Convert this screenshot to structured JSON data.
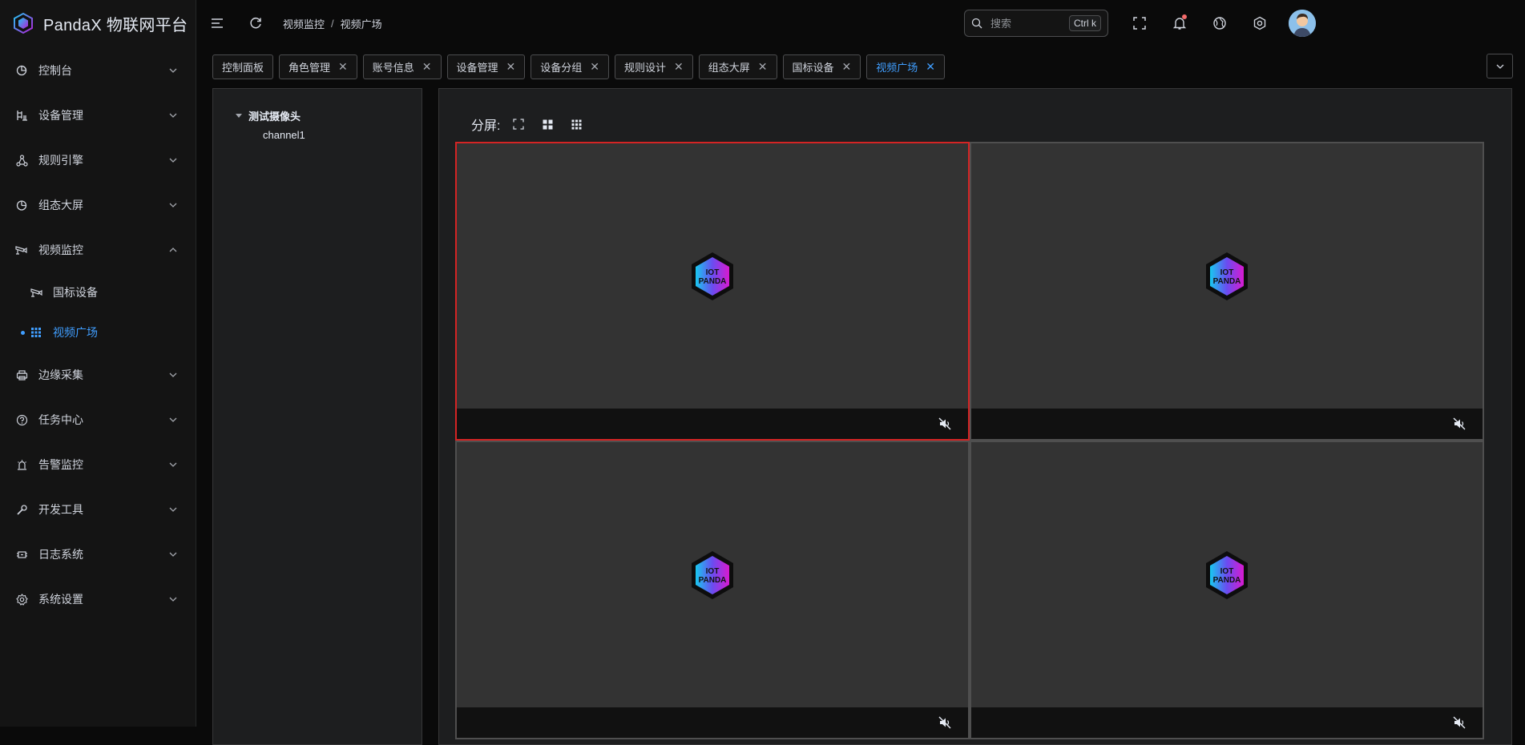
{
  "app": {
    "title": "PandaX 物联网平台"
  },
  "sidebar": {
    "items": [
      {
        "label": "控制台",
        "icon": "dashboard-icon"
      },
      {
        "label": "设备管理",
        "icon": "device-icon"
      },
      {
        "label": "规则引擎",
        "icon": "rule-icon"
      },
      {
        "label": "组态大屏",
        "icon": "pie-icon"
      },
      {
        "label": "视频监控",
        "icon": "camera-icon",
        "expanded": true,
        "children": [
          {
            "label": "国标设备",
            "icon": "camera-icon"
          },
          {
            "label": "视频广场",
            "icon": "grid-icon",
            "active": true
          }
        ]
      },
      {
        "label": "边缘采集",
        "icon": "printer-icon"
      },
      {
        "label": "任务中心",
        "icon": "question-icon"
      },
      {
        "label": "告警监控",
        "icon": "alarm-icon"
      },
      {
        "label": "开发工具",
        "icon": "wrench-icon"
      },
      {
        "label": "日志系统",
        "icon": "log-icon"
      },
      {
        "label": "系统设置",
        "icon": "gear-icon"
      }
    ]
  },
  "header": {
    "breadcrumb": [
      "视频监控",
      "视频广场"
    ],
    "search": {
      "placeholder": "搜索",
      "shortcut": "Ctrl k"
    }
  },
  "tabs": [
    {
      "label": "控制面板",
      "closable": false
    },
    {
      "label": "角色管理",
      "closable": true
    },
    {
      "label": "账号信息",
      "closable": true
    },
    {
      "label": "设备管理",
      "closable": true
    },
    {
      "label": "设备分组",
      "closable": true
    },
    {
      "label": "规则设计",
      "closable": true
    },
    {
      "label": "组态大屏",
      "closable": true
    },
    {
      "label": "国标设备",
      "closable": true
    },
    {
      "label": "视频广场",
      "closable": true,
      "active": true
    }
  ],
  "tree": {
    "root": "测试摄像头",
    "children": [
      "channel1"
    ]
  },
  "video": {
    "split_label": "分屏:",
    "logo_text": [
      "IOT",
      "PANDA"
    ],
    "cells": [
      {
        "selected": true,
        "muted": true
      },
      {
        "selected": false,
        "muted": true
      },
      {
        "selected": false,
        "muted": true
      },
      {
        "selected": false,
        "muted": true
      }
    ]
  },
  "colors": {
    "accent": "#409eff",
    "selected_border": "#d42424",
    "background": "#0a0a0a",
    "panel": "#1d1e1f"
  }
}
